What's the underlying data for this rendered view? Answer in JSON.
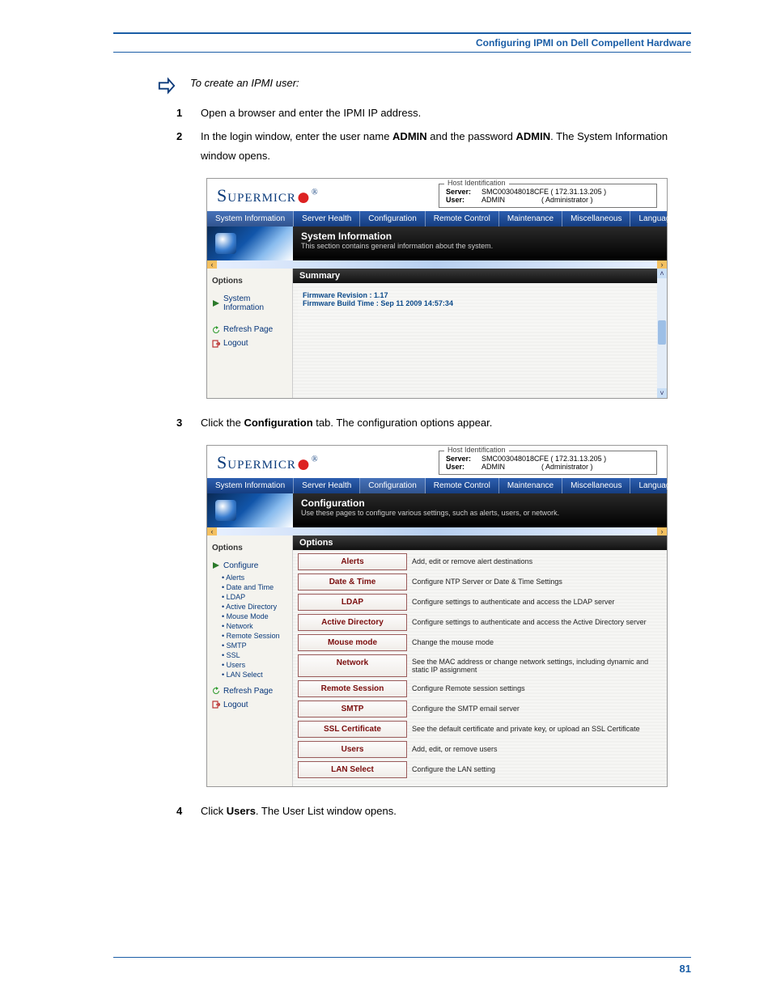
{
  "header": {
    "title": "Configuring IPMI on Dell Compellent Hardware"
  },
  "intro": "To create an IPMI user:",
  "steps": {
    "s1": {
      "num": "1",
      "text": "Open a browser and enter the IPMI IP address."
    },
    "s2": {
      "num": "2",
      "prefix": "In the login window, enter the user name ",
      "bold1": "ADMIN",
      "mid": " and the password ",
      "bold2": "ADMIN",
      "suffix": ". The System Information window opens."
    },
    "s3": {
      "num": "3",
      "prefix": "Click the ",
      "bold1": "Configuration",
      "suffix": " tab. The configuration options appear."
    },
    "s4": {
      "num": "4",
      "prefix": "Click ",
      "bold1": "Users",
      "suffix": ". The User List window opens."
    }
  },
  "ipmi": {
    "logo_text": "Supermicr",
    "hostident_legend": "Host Identification",
    "server_label": "Server:",
    "server_value": "SMC003048018CFE (   172.31.13.205  )",
    "user_label": "User:",
    "user_value": "ADMIN",
    "role_value": "( Administrator )",
    "menu": [
      "System Information",
      "Server Health",
      "Configuration",
      "Remote Control",
      "Maintenance",
      "Miscellaneous",
      "Language"
    ]
  },
  "shot1": {
    "banner_title": "System Information",
    "banner_sub": "This section contains general information about the system.",
    "sidebar_header": "Options",
    "sidebar_items": [
      "System Information",
      "Refresh Page",
      "Logout"
    ],
    "summary_title": "Summary",
    "fw_rev_label": "Firmware Revision :",
    "fw_rev_value": "1.17",
    "fw_build_label": "Firmware Build Time :",
    "fw_build_value": "Sep 11 2009 14:57:34"
  },
  "shot2": {
    "banner_title": "Configuration",
    "banner_sub": "Use these pages to configure various settings, such as alerts, users, or network.",
    "sidebar_header": "Options",
    "sidebar_top": "Configure",
    "sidebar_sub": [
      "Alerts",
      "Date and Time",
      "LDAP",
      "Active Directory",
      "Mouse Mode",
      "Network",
      "Remote Session",
      "SMTP",
      "SSL",
      "Users",
      "LAN Select"
    ],
    "sidebar_items_tail": [
      "Refresh Page",
      "Logout"
    ],
    "options_title": "Options",
    "rows": [
      {
        "btn": "Alerts",
        "desc": "Add, edit or remove alert destinations"
      },
      {
        "btn": "Date & Time",
        "desc": "Configure NTP Server or Date & Time Settings"
      },
      {
        "btn": "LDAP",
        "desc": "Configure settings to authenticate and access the LDAP server"
      },
      {
        "btn": "Active Directory",
        "desc": "Configure settings to authenticate and access the Active Directory server"
      },
      {
        "btn": "Mouse mode",
        "desc": "Change the mouse mode"
      },
      {
        "btn": "Network",
        "desc": "See the MAC address or change network settings, including dynamic and static IP assignment"
      },
      {
        "btn": "Remote Session",
        "desc": "Configure Remote session settings"
      },
      {
        "btn": "SMTP",
        "desc": "Configure the SMTP email server"
      },
      {
        "btn": "SSL Certificate",
        "desc": "See the default certificate and private key, or upload an SSL Certificate"
      },
      {
        "btn": "Users",
        "desc": "Add, edit, or remove users"
      },
      {
        "btn": "LAN Select",
        "desc": "Configure the LAN setting"
      }
    ]
  },
  "footer": {
    "page": "81"
  }
}
